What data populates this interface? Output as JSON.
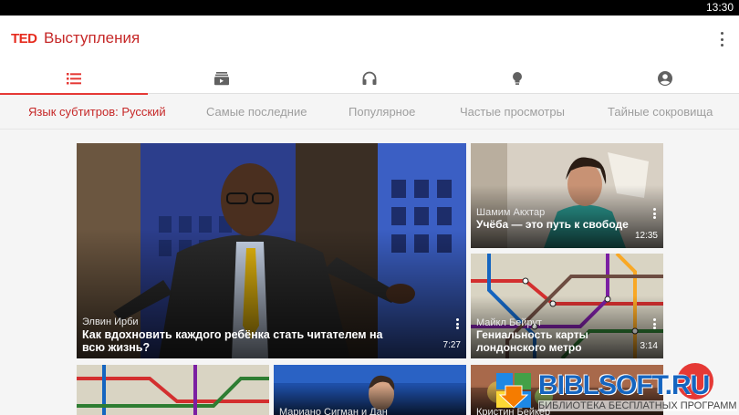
{
  "status": {
    "time": "13:30"
  },
  "appbar": {
    "logo": "TED",
    "title": "Выступления",
    "menu_icon": "overflow-menu-icon"
  },
  "tabs": [
    {
      "icon": "list-icon",
      "active": true
    },
    {
      "icon": "playlist-icon",
      "active": false
    },
    {
      "icon": "headphones-icon",
      "active": false
    },
    {
      "icon": "lightbulb-icon",
      "active": false
    },
    {
      "icon": "account-icon",
      "active": false
    }
  ],
  "filters": [
    "Язык субтитров: Русский",
    "Самые последние",
    "Популярное",
    "Частые просмотры",
    "Тайные сокровища"
  ],
  "talks": {
    "featured": {
      "speaker": "Элвин Ирби",
      "title": "Как вдохновить каждого ребёнка стать читателем на всю жизнь?",
      "duration": "7:27"
    },
    "side1": {
      "speaker": "Шамим Акхтар",
      "title": "Учёба — это путь к свободе",
      "duration": "12:35"
    },
    "side2": {
      "speaker": "Майкл Бейрут",
      "title": "Гениальность карты лондонского метро",
      "duration": "3:14"
    },
    "bottom2": {
      "speaker": "Мариано Сигман и Дан"
    },
    "bottom3": {
      "speaker": "Кристин Бейкер"
    }
  },
  "watermark": {
    "title": "BIBLSOFT.RU",
    "subtitle": "БИБЛИОТЕКА БЕСПЛАТНЫХ ПРОГРАММ"
  },
  "colors": {
    "accent": "#e53935",
    "title": "#c62828",
    "tab_icon": "#616161"
  }
}
